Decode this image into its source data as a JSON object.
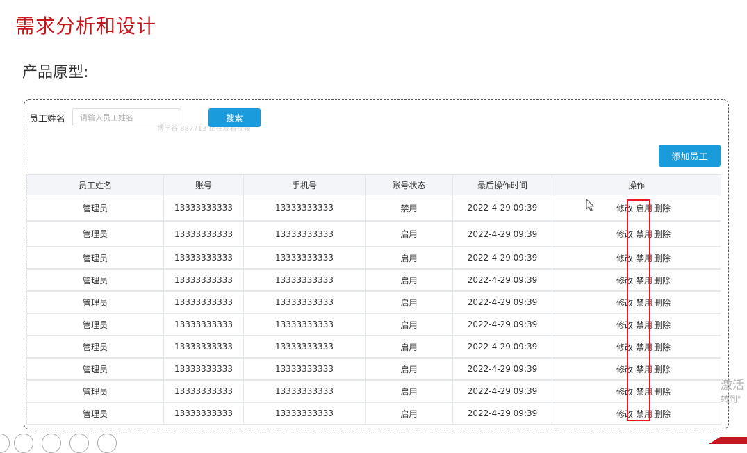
{
  "slide": {
    "title": "需求分析和设计",
    "subtitle": "产品原型:"
  },
  "search": {
    "label": "员工姓名",
    "placeholder": "请输入员工姓名",
    "button": "搜索"
  },
  "watermark": "博学谷 887713 正在观看视频",
  "actions": {
    "add_button": "添加员工"
  },
  "table": {
    "headers": [
      "员工姓名",
      "账号",
      "手机号",
      "账号状态",
      "最后操作时间",
      "操作"
    ],
    "rows": [
      {
        "name": "管理员",
        "account": "13333333333",
        "phone": "13333333333",
        "status": "禁用",
        "time": "2022-4-29 09:39",
        "edit": "修改",
        "toggle": "启用",
        "delete": "删除"
      },
      {
        "name": "管理员",
        "account": "13333333333",
        "phone": "13333333333",
        "status": "启用",
        "time": "2022-4-29 09:39",
        "edit": "修改",
        "toggle": "禁用",
        "delete": "删除"
      },
      {
        "name": "管理员",
        "account": "13333333333",
        "phone": "13333333333",
        "status": "启用",
        "time": "2022-4-29 09:39",
        "edit": "修改",
        "toggle": "禁用",
        "delete": "删除"
      },
      {
        "name": "管理员",
        "account": "13333333333",
        "phone": "13333333333",
        "status": "启用",
        "time": "2022-4-29 09:39",
        "edit": "修改",
        "toggle": "禁用",
        "delete": "删除"
      },
      {
        "name": "管理员",
        "account": "13333333333",
        "phone": "13333333333",
        "status": "启用",
        "time": "2022-4-29 09:39",
        "edit": "修改",
        "toggle": "禁用",
        "delete": "删除"
      },
      {
        "name": "管理员",
        "account": "13333333333",
        "phone": "13333333333",
        "status": "启用",
        "time": "2022-4-29 09:39",
        "edit": "修改",
        "toggle": "禁用",
        "delete": "删除"
      },
      {
        "name": "管理员",
        "account": "13333333333",
        "phone": "13333333333",
        "status": "启用",
        "time": "2022-4-29 09:39",
        "edit": "修改",
        "toggle": "禁用",
        "delete": "删除"
      },
      {
        "name": "管理员",
        "account": "13333333333",
        "phone": "13333333333",
        "status": "启用",
        "time": "2022-4-29 09:39",
        "edit": "修改",
        "toggle": "禁用",
        "delete": "删除"
      },
      {
        "name": "管理员",
        "account": "13333333333",
        "phone": "13333333333",
        "status": "启用",
        "time": "2022-4-29 09:39",
        "edit": "修改",
        "toggle": "禁用",
        "delete": "删除"
      },
      {
        "name": "管理员",
        "account": "13333333333",
        "phone": "13333333333",
        "status": "启用",
        "time": "2022-4-29 09:39",
        "edit": "修改",
        "toggle": "禁用",
        "delete": "删除"
      }
    ]
  },
  "overlay": {
    "activate_title": "激活",
    "activate_sub": "转到\""
  },
  "colors": {
    "title_red": "#c8161d",
    "primary_blue": "#1a9bdc",
    "highlight_red": "#e31b23"
  }
}
